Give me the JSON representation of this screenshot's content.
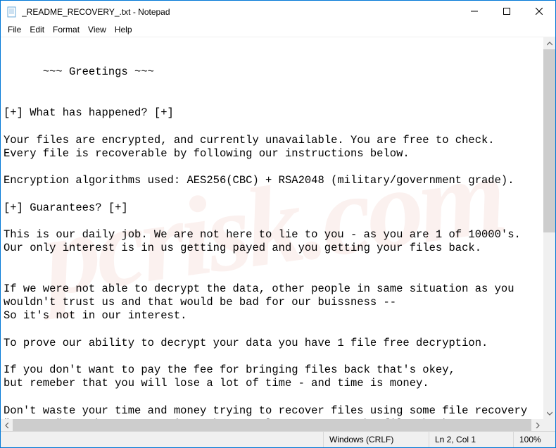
{
  "window": {
    "title": "_README_RECOVERY_.txt - Notepad"
  },
  "menu": {
    "file": "File",
    "edit": "Edit",
    "format": "Format",
    "view": "View",
    "help": "Help"
  },
  "document": {
    "text": "~~~ Greetings ~~~\n\n\n[+] What has happened? [+]\n\nYour files are encrypted, and currently unavailable. You are free to check.\nEvery file is recoverable by following our instructions below.\n\nEncryption algorithms used: AES256(CBC) + RSA2048 (military/government grade).\n\n[+] Guarantees? [+]\n\nThis is our daily job. We are not here to lie to you - as you are 1 of 10000's.\nOur only interest is in us getting payed and you getting your files back.\n\n\nIf we were not able to decrypt the data, other people in same situation as you wouldn't trust us and that would be bad for our buissness --\nSo it's not in our interest.\n\nTo prove our ability to decrypt your data you have 1 file free decryption.\n\nIf you don't want to pay the fee for bringing files back that's okey,\nbut remeber that you will lose a lot of time - and time is money.\n\nDon't waste your time and money trying to recover files using some file recovery \"experts\", we have your private key - only we can get the files back."
  },
  "statusbar": {
    "encoding": "Windows (CRLF)",
    "position": "Ln 2, Col 1",
    "zoom": "100%"
  },
  "watermark": "pcrisk.com"
}
